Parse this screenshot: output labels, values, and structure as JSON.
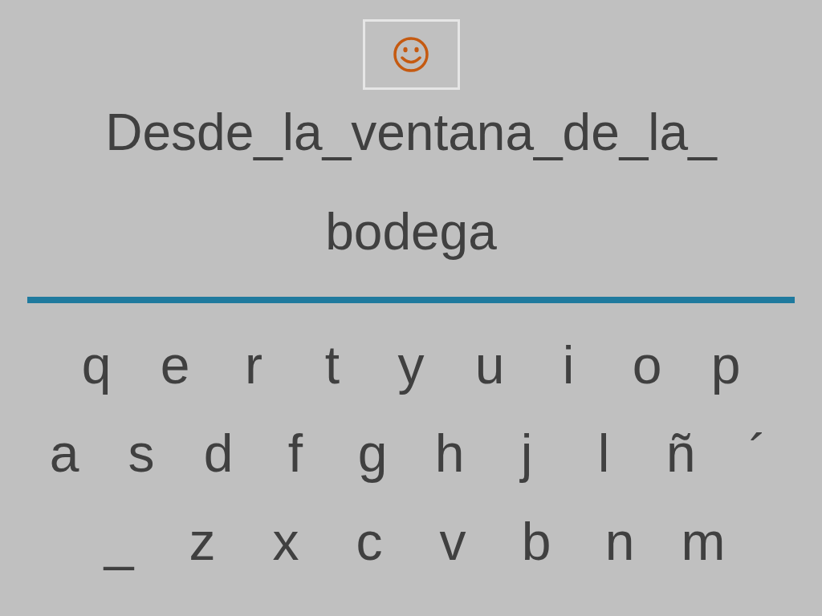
{
  "sentence": {
    "lines": [
      "Desde_la_ventana_de_la_",
      "bodega"
    ]
  },
  "keyboard": {
    "rows": [
      {
        "keys": [
          "q",
          "e",
          "r",
          "t",
          "y",
          "u",
          "i",
          "o",
          "p"
        ]
      },
      {
        "keys": [
          "a",
          "s",
          "d",
          "f",
          "g",
          "h",
          "j",
          "l",
          "ñ",
          "´"
        ]
      },
      {
        "keys": [
          "_",
          "z",
          "x",
          "c",
          "v",
          "b",
          "n",
          "m"
        ]
      }
    ]
  }
}
